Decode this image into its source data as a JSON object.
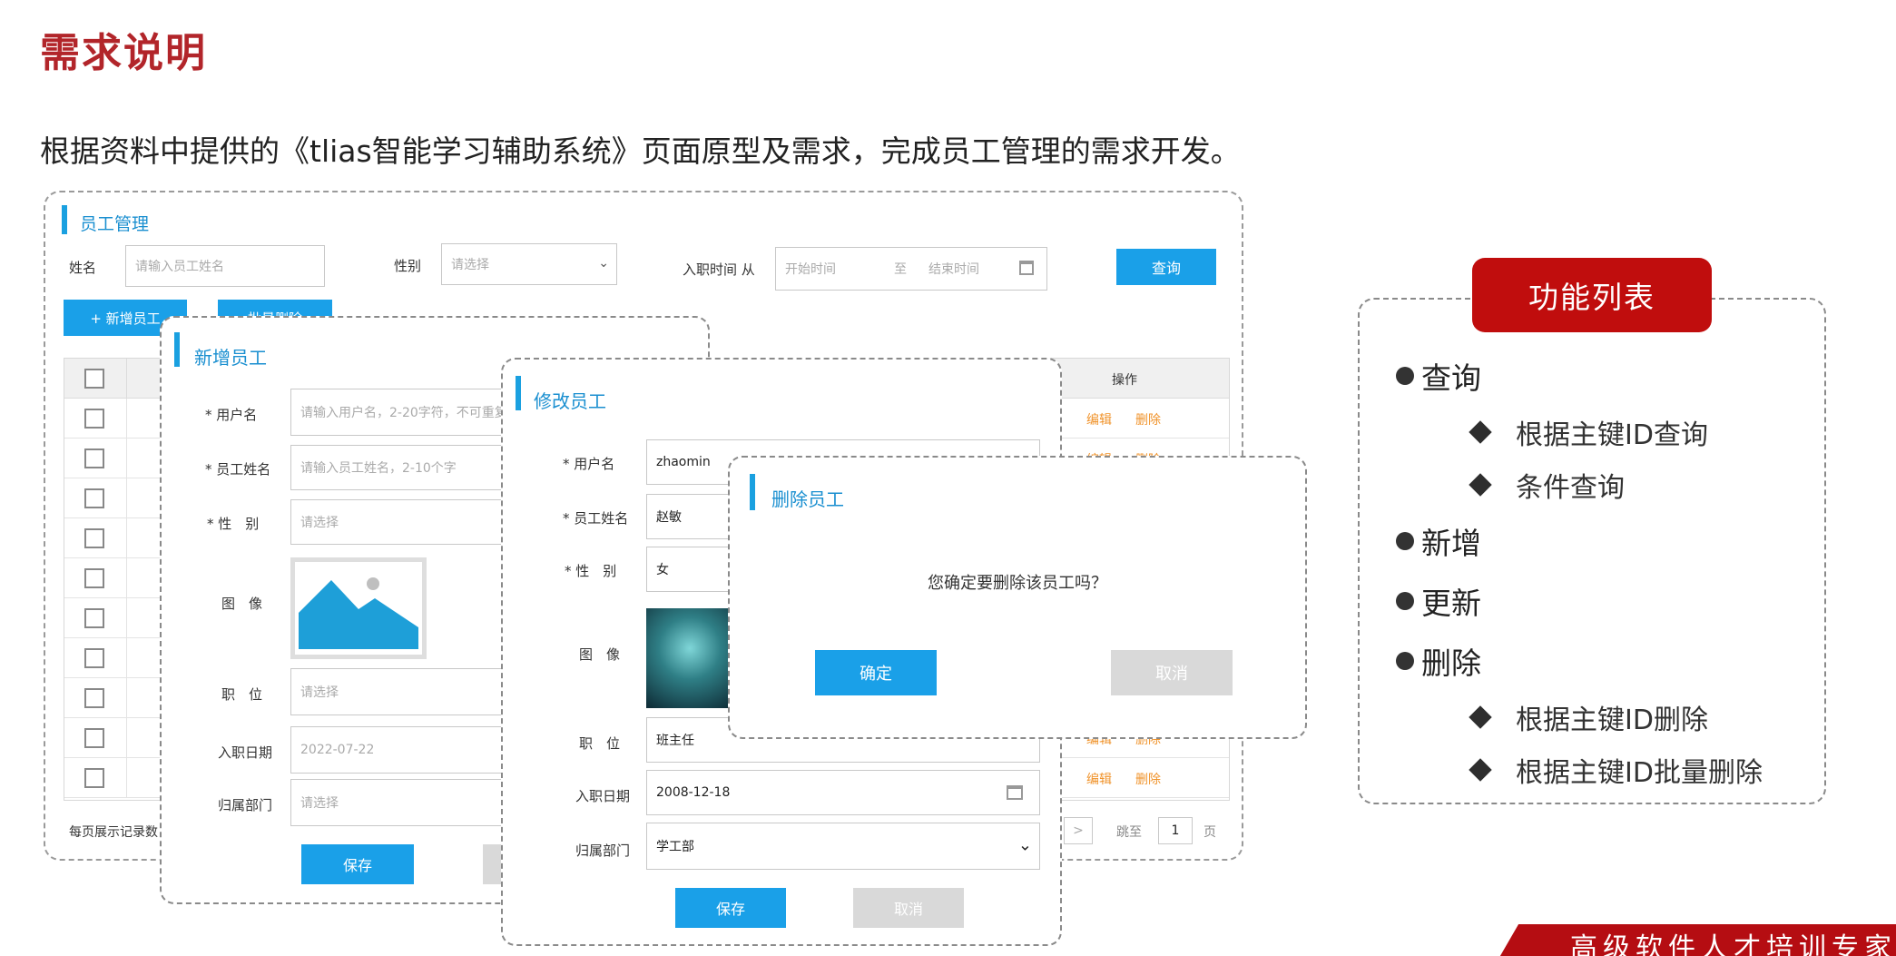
{
  "slide": {
    "title": "需求说明",
    "description": "根据资料中提供的《tlias智能学习辅助系统》页面原型及需求，完成员工管理的需求开发。"
  },
  "employee_mgmt": {
    "section_title": "员工管理",
    "search": {
      "name_label": "姓名",
      "name_placeholder": "请输入员工姓名",
      "gender_label": "性别",
      "gender_placeholder": "请选择",
      "entry_label": "入职时间 从",
      "start_placeholder": "开始时间",
      "range_sep": "至",
      "end_placeholder": "结束时间",
      "query_button": "查询"
    },
    "add_button": "+ 新增员工",
    "batch_delete_button": "批量删除",
    "table": {
      "op_header": "操作",
      "edit_label": "编辑",
      "delete_label": "删除",
      "row_count": 10
    },
    "footer": {
      "page_size_label": "每页展示记录数",
      "next_arrow": ">",
      "goto_label": "跳至",
      "page_value": "1",
      "page_suffix": "页"
    }
  },
  "add_dialog": {
    "title": "新增员工",
    "username_label": "* 用户名",
    "username_placeholder": "请输入用户名，2-20字符，不可重复",
    "name_label": "* 员工姓名",
    "name_placeholder": "请输入员工姓名，2-10个字",
    "gender_label": "* 性　别",
    "gender_placeholder": "请选择",
    "image_label": "图　像",
    "job_label": "职　位",
    "job_placeholder": "请选择",
    "entry_label": "入职日期",
    "entry_value": "2022-07-22",
    "dept_label": "归属部门",
    "dept_placeholder": "请选择",
    "save_button": "保存"
  },
  "edit_dialog": {
    "title": "修改员工",
    "username_label": "* 用户名",
    "username_value": "zhaomin",
    "name_label": "* 员工姓名",
    "name_value": "赵敏",
    "gender_label": "* 性　别",
    "gender_value": "女",
    "image_label": "图　像",
    "job_label": "职　位",
    "job_value": "班主任",
    "entry_label": "入职日期",
    "entry_value": "2008-12-18",
    "dept_label": "归属部门",
    "dept_value": "学工部",
    "save_button": "保存",
    "cancel_button": "取消"
  },
  "delete_dialog": {
    "title": "删除员工",
    "message": "您确定要删除该员工吗？",
    "confirm_button": "确定",
    "cancel_button": "取消"
  },
  "features": {
    "title": "功能列表",
    "items": [
      {
        "label": "查询",
        "children": [
          "根据主键ID查询",
          "条件查询"
        ]
      },
      {
        "label": "新增",
        "children": []
      },
      {
        "label": "更新",
        "children": []
      },
      {
        "label": "删除",
        "children": [
          "根据主键ID删除",
          "根据主键ID批量删除"
        ]
      }
    ]
  },
  "footer_banner": "高级软件人才培训专家",
  "colors": {
    "title_red": "#b2252a",
    "badge_red": "#c00d0d",
    "primary_blue": "#1aa0e8",
    "link_orange": "#f0932b"
  }
}
